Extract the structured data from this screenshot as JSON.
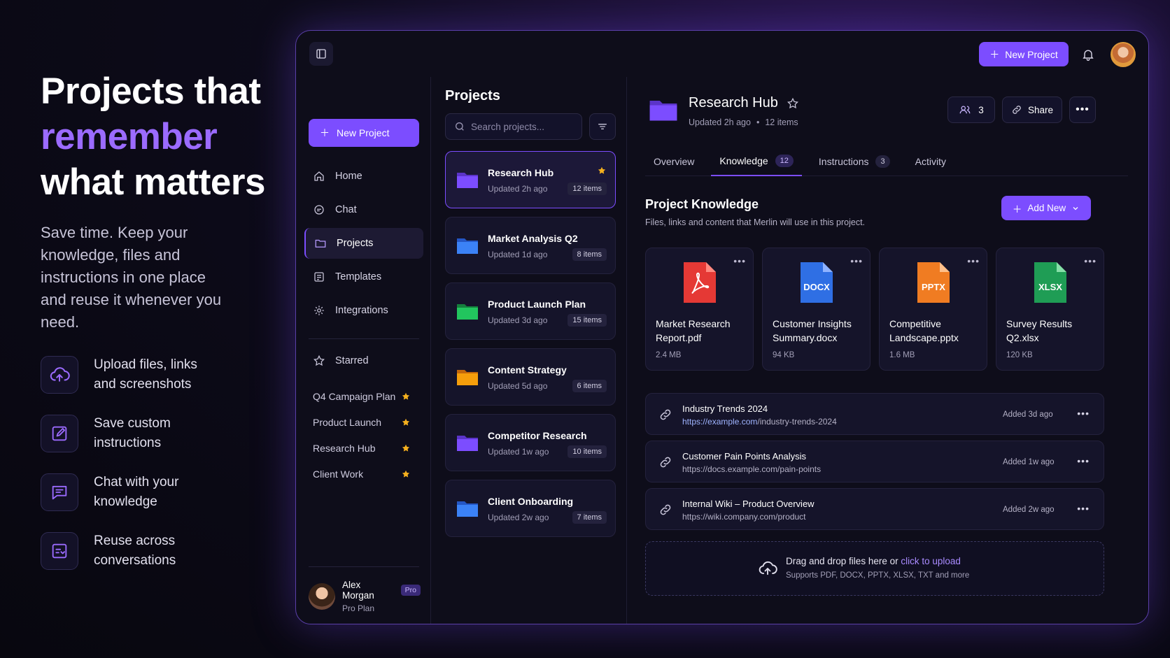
{
  "hero": {
    "title_line1": "Projects that",
    "title_line2": "remember",
    "title_line3": "what matters",
    "subtitle": "Save time. Keep your knowledge, files and instructions in one place and reuse it whenever you need.",
    "features": [
      {
        "icon": "cloud-upload-icon",
        "text": "Upload files, links and screenshots"
      },
      {
        "icon": "edit-icon",
        "text": "Save custom instructions"
      },
      {
        "icon": "chat-icon",
        "text": "Chat with your knowledge"
      },
      {
        "icon": "reuse-icon",
        "text": "Reuse across conversations"
      }
    ]
  },
  "topbar": {
    "new_project_label": "New Project"
  },
  "sidebar": {
    "new_project_label": "New Project",
    "nav": [
      {
        "label": "Home",
        "icon": "home-icon"
      },
      {
        "label": "Chat",
        "icon": "chat-icon"
      },
      {
        "label": "Projects",
        "icon": "folder-icon",
        "active": true
      },
      {
        "label": "Templates",
        "icon": "template-icon"
      },
      {
        "label": "Integrations",
        "icon": "integrations-icon"
      }
    ],
    "starred_label": "Starred",
    "starred": [
      "Q4 Campaign Plan",
      "Product Launch",
      "Research Hub",
      "Client Work"
    ],
    "user": {
      "name": "Alex Morgan",
      "badge": "Pro",
      "plan": "Pro Plan"
    }
  },
  "projects": {
    "heading": "Projects",
    "search_placeholder": "Search projects...",
    "items": [
      {
        "name": "Research Hub",
        "updated": "Updated 2h ago",
        "count": "12 items",
        "color": "#7c4dff",
        "starred": true,
        "active": true
      },
      {
        "name": "Market Analysis Q2",
        "updated": "Updated 1d ago",
        "count": "8 items",
        "color": "#3b82f6"
      },
      {
        "name": "Product Launch Plan",
        "updated": "Updated 3d ago",
        "count": "15 items",
        "color": "#22c55e"
      },
      {
        "name": "Content Strategy",
        "updated": "Updated 5d ago",
        "count": "6 items",
        "color": "#f59e0b"
      },
      {
        "name": "Competitor Research",
        "updated": "Updated 1w ago",
        "count": "10 items",
        "color": "#7c4dff"
      },
      {
        "name": "Client Onboarding",
        "updated": "Updated 2w ago",
        "count": "7 items",
        "color": "#3b82f6"
      }
    ]
  },
  "detail": {
    "title": "Research Hub",
    "updated": "Updated 2h ago",
    "items": "12 items",
    "members": "3",
    "share_label": "Share",
    "tabs": [
      {
        "label": "Overview",
        "count": ""
      },
      {
        "label": "Knowledge",
        "count": "12",
        "active": true
      },
      {
        "label": "Instructions",
        "count": "3"
      },
      {
        "label": "Activity",
        "count": ""
      }
    ],
    "knowledge_title": "Project Knowledge",
    "knowledge_subtitle": "Files, links and content that Merlin will use in this project.",
    "add_new_label": "Add New",
    "files": [
      {
        "name": "Market Research Report.pdf",
        "size": "2.4 MB",
        "type": "PDF",
        "color": "#e53935"
      },
      {
        "name": "Customer Insights Summary.docx",
        "size": "94 KB",
        "type": "DOCX",
        "color": "#2f6fe4"
      },
      {
        "name": "Competitive Landscape.pptx",
        "size": "1.6 MB",
        "type": "PPTX",
        "color": "#f07c22"
      },
      {
        "name": "Survey Results Q2.xlsx",
        "size": "120 KB",
        "type": "XLSX",
        "color": "#1f9d55"
      }
    ],
    "links": [
      {
        "title": "Industry Trends 2024",
        "url_host": "https://example.com",
        "url_path": "/industry-trends-2024",
        "added": "Added 3d ago"
      },
      {
        "title": "Customer Pain Points Analysis",
        "url_host": "",
        "url_path": "https://docs.example.com/pain-points",
        "added": "Added 1w ago"
      },
      {
        "title": "Internal Wiki – Product Overview",
        "url_host": "",
        "url_path": "https://wiki.company.com/product",
        "added": "Added 2w ago"
      }
    ],
    "dropzone": {
      "main": "Drag and drop files here or",
      "link": "click to upload",
      "sub": "Supports PDF, DOCX, PPTX, XLSX, TXT and more"
    }
  },
  "colors": {
    "accent": "#7c4dff",
    "star": "#f5b01e"
  }
}
